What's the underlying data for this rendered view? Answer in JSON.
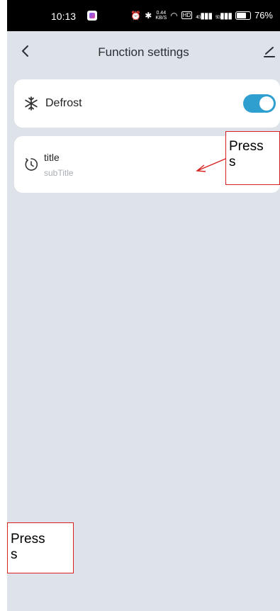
{
  "status_bar": {
    "time": "10:13",
    "speed_value": "0.44",
    "speed_unit": "KB/S",
    "hd_label": "HD",
    "signal_4g": "4G",
    "signal_5g": "5G",
    "battery": "76%"
  },
  "header": {
    "title": "Function settings",
    "back_icon": "chevron-left-icon",
    "edit_icon": "pencil-icon"
  },
  "settings": {
    "defrost": {
      "label": "Defrost",
      "icon": "snowflake-icon",
      "enabled": true
    },
    "timer": {
      "title": "title",
      "subtitle": "subTitle",
      "icon": "timer-icon"
    }
  },
  "annotations": {
    "top_label_1": "Press",
    "top_label_2": "s",
    "bottom_label_1": "Press",
    "bottom_label_2": "s"
  },
  "colors": {
    "background": "#dde3e8",
    "toggle_on": "#2f9fcf",
    "annotation_border": "#d82020"
  }
}
